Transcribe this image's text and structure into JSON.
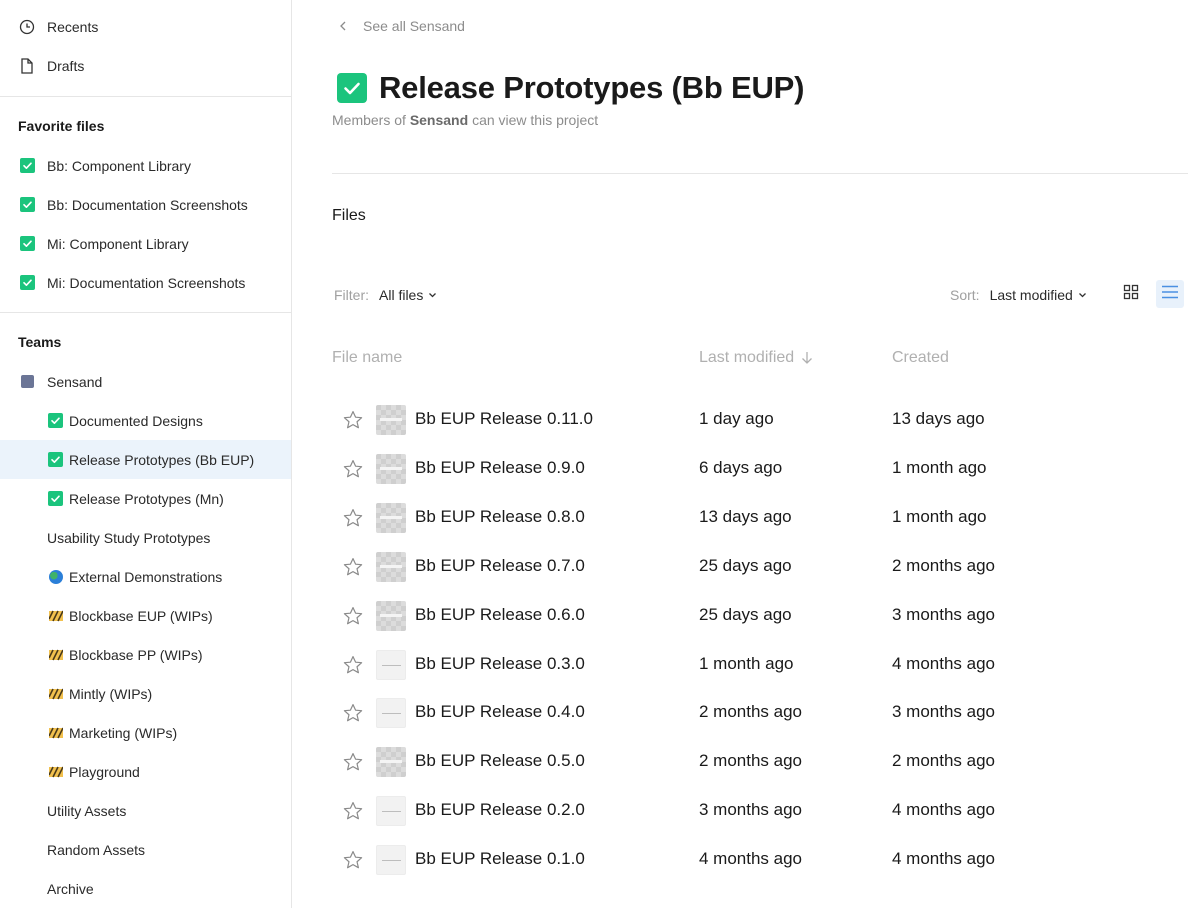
{
  "sidebar": {
    "top_items": [
      {
        "label": "Recents",
        "icon": "clock-icon"
      },
      {
        "label": "Drafts",
        "icon": "file-icon"
      }
    ],
    "favorites_heading": "Favorite files",
    "favorites": [
      {
        "label": "Bb: Component Library",
        "icon": "green-check-icon"
      },
      {
        "label": "Bb: Documentation Screenshots",
        "icon": "green-check-icon"
      },
      {
        "label": "Mi: Component Library",
        "icon": "green-check-icon"
      },
      {
        "label": "Mi: Documentation Screenshots",
        "icon": "green-check-icon"
      }
    ],
    "teams_heading": "Teams",
    "team": {
      "label": "Sensand",
      "icon": "team-square-icon"
    },
    "projects": [
      {
        "label": "Documented Designs",
        "icon": "green-check-icon"
      },
      {
        "label": "Release Prototypes (Bb EUP)",
        "icon": "green-check-icon",
        "active": true
      },
      {
        "label": "Release Prototypes (Mn)",
        "icon": "green-check-icon"
      },
      {
        "label": "Usability Study Prototypes",
        "icon": ""
      },
      {
        "label": "External Demonstrations",
        "icon": "globe-icon"
      },
      {
        "label": "Blockbase EUP (WIPs)",
        "icon": "construction-icon"
      },
      {
        "label": "Blockbase PP (WIPs)",
        "icon": "construction-icon"
      },
      {
        "label": "Mintly (WIPs)",
        "icon": "construction-icon"
      },
      {
        "label": "Marketing (WIPs)",
        "icon": "construction-icon"
      },
      {
        "label": "Playground",
        "icon": "construction-icon"
      },
      {
        "label": "Utility Assets",
        "icon": ""
      },
      {
        "label": "Random Assets",
        "icon": ""
      },
      {
        "label": "Archive",
        "icon": ""
      }
    ]
  },
  "header": {
    "back_label": "See all Sensand",
    "title": "Release Prototypes (Bb EUP)",
    "subtitle_prefix": "Members of",
    "subtitle_team": "Sensand",
    "subtitle_suffix": "can view this project"
  },
  "files_section": {
    "title": "Files",
    "filter_label": "Filter:",
    "filter_value": "All files",
    "sort_label": "Sort:",
    "sort_value": "Last modified",
    "columns": {
      "name": "File name",
      "modified": "Last modified",
      "created": "Created"
    },
    "rows": [
      {
        "name": "Bb EUP Release 0.11.0",
        "modified": "1 day ago",
        "created": "13 days ago",
        "thumb": "checker"
      },
      {
        "name": "Bb EUP Release 0.9.0",
        "modified": "6 days ago",
        "created": "1 month ago",
        "thumb": "checker"
      },
      {
        "name": "Bb EUP Release 0.8.0",
        "modified": "13 days ago",
        "created": "1 month ago",
        "thumb": "checker"
      },
      {
        "name": "Bb EUP Release 0.7.0",
        "modified": "25 days ago",
        "created": "2 months ago",
        "thumb": "checker"
      },
      {
        "name": "Bb EUP Release 0.6.0",
        "modified": "25 days ago",
        "created": "3 months ago",
        "thumb": "checker"
      },
      {
        "name": "Bb EUP Release 0.3.0",
        "modified": "1 month ago",
        "created": "4 months ago",
        "thumb": "light"
      },
      {
        "name": "Bb EUP Release 0.4.0",
        "modified": "2 months ago",
        "created": "3 months ago",
        "thumb": "light"
      },
      {
        "name": "Bb EUP Release 0.5.0",
        "modified": "2 months ago",
        "created": "2 months ago",
        "thumb": "checker"
      },
      {
        "name": "Bb EUP Release 0.2.0",
        "modified": "3 months ago",
        "created": "4 months ago",
        "thumb": "light"
      },
      {
        "name": "Bb EUP Release 0.1.0",
        "modified": "4 months ago",
        "created": "4 months ago",
        "thumb": "light"
      }
    ]
  },
  "colors": {
    "accent_green": "#1bc47d",
    "active_row": "#ebf3fb",
    "list_view_blue": "#4a90e2"
  }
}
